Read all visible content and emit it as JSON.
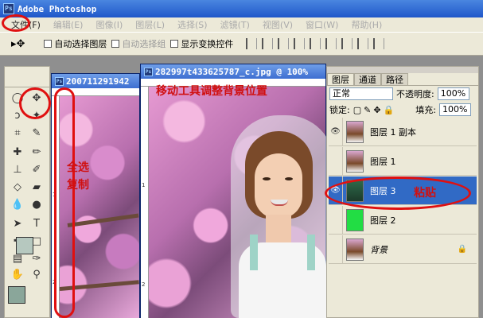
{
  "app": {
    "title": "Adobe Photoshop",
    "logo": "Ps"
  },
  "menu": {
    "items": [
      "文件(F)",
      "编辑(E)",
      "图像(I)",
      "图层(L)",
      "选择(S)",
      "滤镜(T)",
      "视图(V)",
      "窗口(W)",
      "帮助(H)"
    ]
  },
  "options": {
    "tool": "▸✥",
    "auto_select_layer": "自动选择图层",
    "auto_select_group": "自动选择组",
    "show_transform": "显示变换控件"
  },
  "documents": [
    {
      "title": "200711291942"
    },
    {
      "title": "282997t433625787_c.jpg @ 100%"
    }
  ],
  "rulers": {
    "v1": "1",
    "v2": "2",
    "v3": "1",
    "v4": "2"
  },
  "layers_panel": {
    "tabs": [
      "图层",
      "通道",
      "路径"
    ],
    "blend_mode": "正常",
    "opacity_label": "不透明度:",
    "opacity_value": "100%",
    "lock_label": "锁定:",
    "fill_label": "填充:",
    "fill_value": "100%",
    "layers": [
      {
        "name": "图层 1 副本",
        "visible": true
      },
      {
        "name": "图层 1",
        "visible": false
      },
      {
        "name": "图层 3",
        "visible": true,
        "selected": true
      },
      {
        "name": "图层 2",
        "visible": false
      },
      {
        "name": "背景",
        "visible": false,
        "locked": true
      }
    ]
  },
  "annotations": {
    "move_tool_note": "移动工具调整背景位置",
    "select_all": "全选",
    "copy": "复制",
    "paste": "粘贴"
  },
  "colors": {
    "annotation_red": "#d01010",
    "selected_layer": "#316ac5",
    "green_layer": "#22dd44"
  }
}
